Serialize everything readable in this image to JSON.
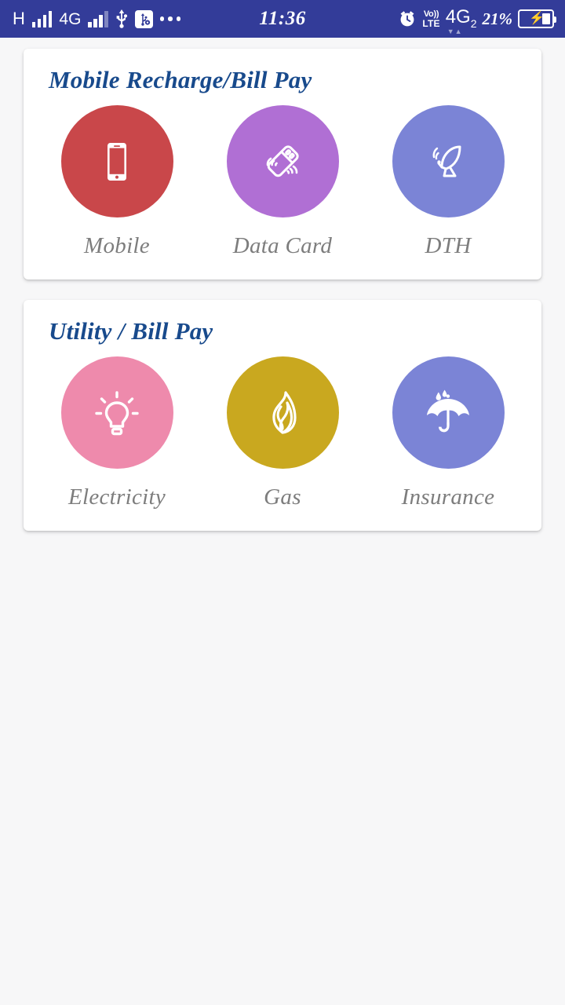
{
  "status_bar": {
    "background_color": "#333c99",
    "network_letter": "H",
    "network_type": "4G",
    "usb_icon": "usb-icon",
    "usb_settings_icon": "usb-settings-icon",
    "overflow_icon": "more-dots-icon",
    "time": "11:36",
    "alarm_icon": "alarm-clock-icon",
    "volte_top": "Vo))",
    "volte_bottom": "LTE",
    "sim_network": "4G",
    "sim_index": "2",
    "battery_percent": "21%",
    "battery_charging_icon": "charging-bolt-icon"
  },
  "cards": [
    {
      "title": "Mobile Recharge/Bill Pay",
      "title_color": "#184a8c",
      "tiles": [
        {
          "label": "Mobile",
          "icon": "smartphone-icon",
          "color": "#c9474a"
        },
        {
          "label": "Data Card",
          "icon": "usb-dongle-icon",
          "color": "#b06fd4"
        },
        {
          "label": "DTH",
          "icon": "satellite-dish-icon",
          "color": "#7b84d6"
        }
      ]
    },
    {
      "title": "Utility / Bill Pay",
      "title_color": "#184a8c",
      "tiles": [
        {
          "label": "Electricity",
          "icon": "light-bulb-icon",
          "color": "#ee8aac"
        },
        {
          "label": "Gas",
          "icon": "flame-icon",
          "color": "#c9a81f"
        },
        {
          "label": "Insurance",
          "icon": "umbrella-icon",
          "color": "#7b84d6"
        }
      ]
    }
  ],
  "page_background": "#f7f7f8"
}
